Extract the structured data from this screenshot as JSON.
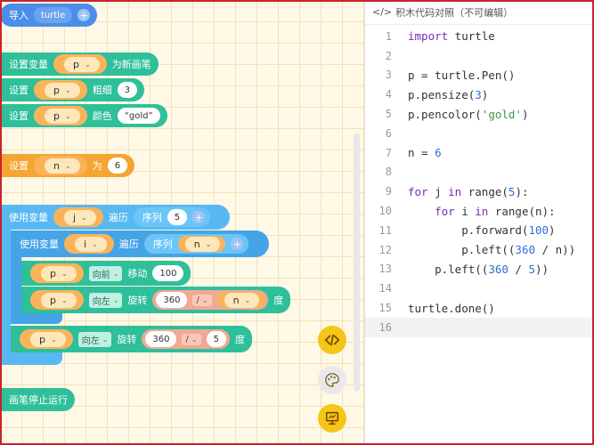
{
  "import_block": {
    "label": "导入",
    "module": "turtle"
  },
  "setvar_block": {
    "label": "设置变量",
    "var": "p",
    "suffix": "为新画笔"
  },
  "pensize_block": {
    "label": "设置",
    "var": "p",
    "prop": "粗细",
    "value": "3"
  },
  "pencolor_block": {
    "label": "设置",
    "var": "p",
    "prop": "颜色",
    "value": "“gold”"
  },
  "n_block": {
    "label": "设置",
    "var": "n",
    "mid": "为",
    "value": "6"
  },
  "outer_loop": {
    "label": "使用变量",
    "var": "j",
    "iter": "遍历",
    "seq": "序列",
    "seq_val": "5"
  },
  "inner_loop": {
    "label": "使用变量",
    "var": "i",
    "iter": "遍历",
    "seq": "序列",
    "seq_val": "n"
  },
  "forward_block": {
    "var": "p",
    "dir": "向前",
    "action": "移动",
    "value": "100"
  },
  "left_block": {
    "var": "p",
    "dir": "向左",
    "action": "旋转",
    "a": "360",
    "op": "/",
    "b": "n",
    "unit": "度"
  },
  "left2_block": {
    "var": "p",
    "dir": "向左",
    "action": "旋转",
    "a": "360",
    "op": "/",
    "b": "5",
    "unit": "度"
  },
  "done_block": {
    "label": "画笔停止运行"
  },
  "tools": {
    "code_icon": "code-icon",
    "palette_icon": "palette-icon",
    "screen_icon": "screen-icon"
  },
  "code_panel": {
    "title": "积木代码对照（不可编辑）",
    "lines": [
      "import turtle",
      "",
      "p = turtle.Pen()",
      "p.pensize(3)",
      "p.pencolor('gold')",
      "",
      "n = 6",
      "",
      "for j in range(5):",
      "    for i in range(n):",
      "        p.forward(100)",
      "        p.left((360 / n))",
      "    p.left((360 / 5))",
      "",
      "turtle.done()",
      ""
    ]
  },
  "colors": {
    "blue": "#4b8ee7",
    "teal": "#2fbf9a",
    "orange": "#f5a531",
    "sky": "#58b9f2",
    "accent": "#f5c518"
  }
}
